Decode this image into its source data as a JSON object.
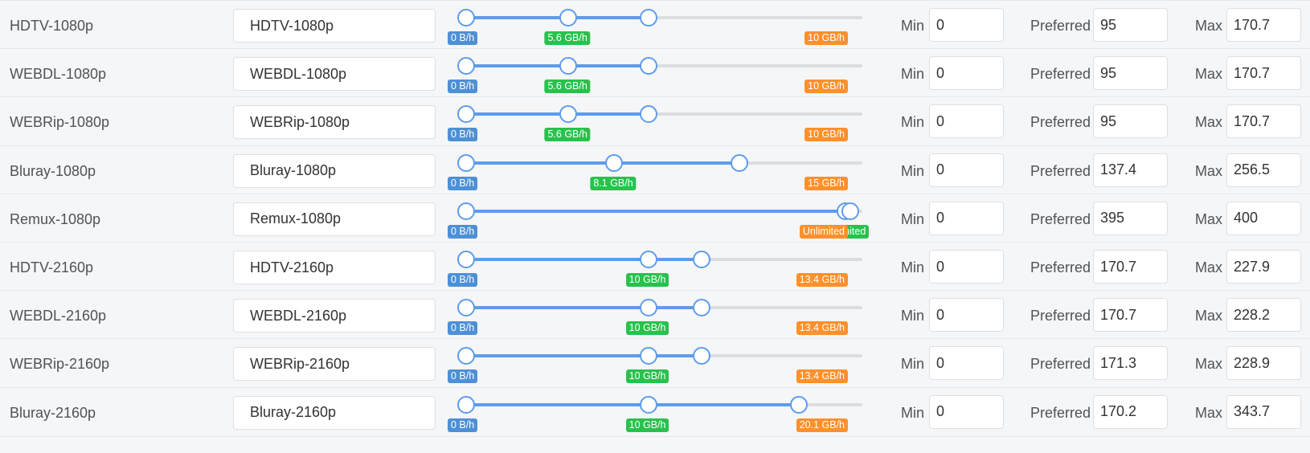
{
  "labels": {
    "min": "Min",
    "preferred": "Preferred",
    "max": "Max"
  },
  "colors": {
    "accent": "#5d9cec",
    "min_badge": "#4d90d6",
    "preferred_badge": "#27c24c",
    "max_badge": "#ff902b"
  },
  "scale_max_gb_per_hour": 21.1,
  "rows": [
    {
      "name": "HDTV-1080p",
      "title": "HDTV-1080p",
      "min": "0",
      "preferred": "95",
      "max": "170.7",
      "min_label": "0 B/h",
      "preferred_label": "5.6 GB/h",
      "max_label": "10 GB/h",
      "pref_pos": 0.266,
      "max_pos": 0.474
    },
    {
      "name": "WEBDL-1080p",
      "title": "WEBDL-1080p",
      "min": "0",
      "preferred": "95",
      "max": "170.7",
      "min_label": "0 B/h",
      "preferred_label": "5.6 GB/h",
      "max_label": "10 GB/h",
      "pref_pos": 0.266,
      "max_pos": 0.474
    },
    {
      "name": "WEBRip-1080p",
      "title": "WEBRip-1080p",
      "min": "0",
      "preferred": "95",
      "max": "170.7",
      "min_label": "0 B/h",
      "preferred_label": "5.6 GB/h",
      "max_label": "10 GB/h",
      "pref_pos": 0.266,
      "max_pos": 0.474
    },
    {
      "name": "Bluray-1080p",
      "title": "Bluray-1080p",
      "min": "0",
      "preferred": "137.4",
      "max": "256.5",
      "min_label": "0 B/h",
      "preferred_label": "8.1 GB/h",
      "max_label": "15 GB/h",
      "pref_pos": 0.385,
      "max_pos": 0.711
    },
    {
      "name": "Remux-1080p",
      "title": "Remux-1080p",
      "min": "0",
      "preferred": "395",
      "max": "400",
      "min_label": "0 B/h",
      "preferred_label": "Unlimited",
      "max_label": "Unlimited",
      "pref_pos": 0.988,
      "max_pos": 1.0
    },
    {
      "name": "HDTV-2160p",
      "title": "HDTV-2160p",
      "min": "0",
      "preferred": "170.7",
      "max": "227.9",
      "min_label": "0 B/h",
      "preferred_label": "10 GB/h",
      "max_label": "13.4 GB/h",
      "pref_pos": 0.474,
      "max_pos": 0.614
    },
    {
      "name": "WEBDL-2160p",
      "title": "WEBDL-2160p",
      "min": "0",
      "preferred": "170.7",
      "max": "228.2",
      "min_label": "0 B/h",
      "preferred_label": "10 GB/h",
      "max_label": "13.4 GB/h",
      "pref_pos": 0.474,
      "max_pos": 0.614
    },
    {
      "name": "WEBRip-2160p",
      "title": "WEBRip-2160p",
      "min": "0",
      "preferred": "171.3",
      "max": "228.9",
      "min_label": "0 B/h",
      "preferred_label": "10 GB/h",
      "max_label": "13.4 GB/h",
      "pref_pos": 0.474,
      "max_pos": 0.614
    },
    {
      "name": "Bluray-2160p",
      "title": "Bluray-2160p",
      "min": "0",
      "preferred": "170.2",
      "max": "343.7",
      "min_label": "0 B/h",
      "preferred_label": "10 GB/h",
      "max_label": "20.1 GB/h",
      "pref_pos": 0.474,
      "max_pos": 0.866
    }
  ]
}
